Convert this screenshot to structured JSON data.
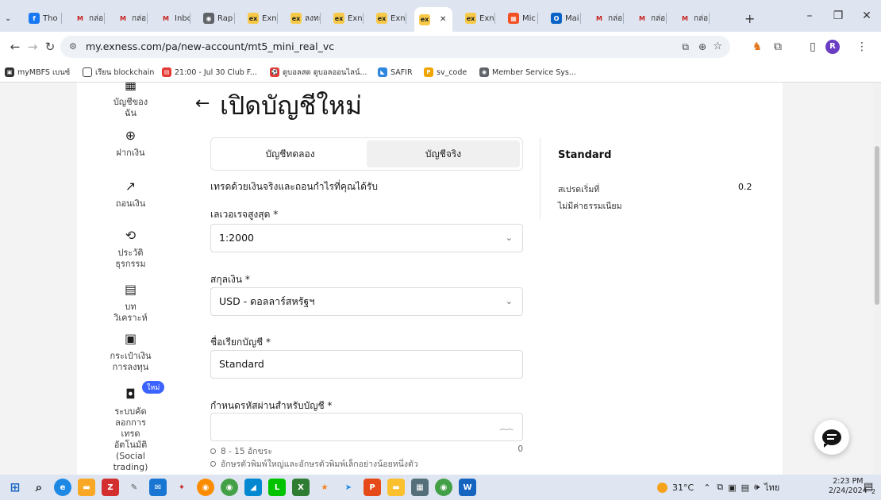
{
  "browser": {
    "tabs": [
      {
        "label": "Tho",
        "icon": "facebook-icon",
        "color": "#1877f2",
        "glyph": "f"
      },
      {
        "label": "กล่อ",
        "icon": "gmail-icon",
        "color": "#ffffff",
        "glyph": "M"
      },
      {
        "label": "กล่อ",
        "icon": "gmail-icon",
        "color": "#ffffff",
        "glyph": "M"
      },
      {
        "label": "Inbc",
        "icon": "gmail-icon",
        "color": "#ffffff",
        "glyph": "M"
      },
      {
        "label": "Rap",
        "icon": "globe-icon",
        "color": "#5f6368",
        "glyph": "◉"
      },
      {
        "label": "Exne",
        "icon": "exness-icon",
        "color": "#f7c948",
        "glyph": "ex"
      },
      {
        "label": "ลงทะ",
        "icon": "exness-icon",
        "color": "#f7c948",
        "glyph": "ex"
      },
      {
        "label": "Exne",
        "icon": "exness-icon",
        "color": "#f7c948",
        "glyph": "ex"
      },
      {
        "label": "Exne",
        "icon": "exness-icon",
        "color": "#f7c948",
        "glyph": "ex"
      },
      {
        "label": "",
        "icon": "exness-icon",
        "color": "#f7c948",
        "glyph": "ex",
        "active": true
      },
      {
        "label": "Exne",
        "icon": "exness-icon",
        "color": "#f7c948",
        "glyph": "ex"
      },
      {
        "label": "Mic",
        "icon": "microsoft-icon",
        "color": "#f25022",
        "glyph": "▦"
      },
      {
        "label": "Mai",
        "icon": "outlook-icon",
        "color": "#0a64c8",
        "glyph": "O"
      },
      {
        "label": "กล่อ",
        "icon": "gmail-icon",
        "color": "#ffffff",
        "glyph": "M"
      },
      {
        "label": "กล่อ",
        "icon": "gmail-icon",
        "color": "#ffffff",
        "glyph": "M"
      },
      {
        "label": "กล่อ",
        "icon": "gmail-icon",
        "color": "#ffffff",
        "glyph": "M"
      }
    ],
    "url": "my.exness.com/pa/new-account/mt5_mini_real_vc",
    "profile_initial": "R",
    "bookmarks": [
      {
        "label": "myMBFS เบนซ์",
        "icon": "mbfs-icon",
        "color": "#333333",
        "glyph": "▣"
      },
      {
        "label": "เรียน blockchain",
        "icon": "folder-icon",
        "color": "#ffffff",
        "glyph": "▭"
      },
      {
        "label": "21:00 - Jul 30 Club F...",
        "icon": "calendar-icon",
        "color": "#e53935",
        "glyph": "▤"
      },
      {
        "label": "ดูบอลสด ดูบอลออนไลน์...",
        "icon": "football-icon",
        "color": "#e53935",
        "glyph": "⚽"
      },
      {
        "label": "SAFIR",
        "icon": "safir-icon",
        "color": "#2e86de",
        "glyph": "◣"
      },
      {
        "label": "sv_code",
        "icon": "pma-icon",
        "color": "#f0a500",
        "glyph": "P"
      },
      {
        "label": "Member Service Sys...",
        "icon": "globe-icon",
        "color": "#5f6368",
        "glyph": "◉"
      }
    ]
  },
  "sidebar": {
    "items": [
      {
        "label": "บัญชีของฉัน",
        "icon": "accounts-icon",
        "glyph": "▦"
      },
      {
        "label": "ฝากเงิน",
        "icon": "deposit-icon",
        "glyph": "⊕"
      },
      {
        "label": "ถอนเงิน",
        "icon": "withdraw-icon",
        "glyph": "↗"
      },
      {
        "label": "ประวัติธุรกรรม",
        "icon": "history-icon",
        "glyph": "⟲"
      },
      {
        "label": "บทวิเคราะห์",
        "icon": "analytics-icon",
        "glyph": "▤"
      },
      {
        "label": "กระเป๋าเงินการลงทุน",
        "icon": "wallet-icon",
        "glyph": "▣"
      },
      {
        "label": "ระบบคัดลอกการเทรดอัตโนมัติ (Social trading)",
        "icon": "social-trading-icon",
        "glyph": "◘",
        "badge": "ใหม่"
      }
    ]
  },
  "main": {
    "back_glyph": "←",
    "title": "เปิดบัญชีใหม่",
    "tabs": [
      {
        "label": "บัญชีทดลอง",
        "active": false
      },
      {
        "label": "บัญชีจริง",
        "active": true
      }
    ],
    "description": "เทรดด้วยเงินจริงและถอนกำไรที่คุณได้รับ",
    "leverage_label": "เลเวอเรจสูงสุด *",
    "leverage_value": "1:2000",
    "currency_label": "สกุลเงิน *",
    "currency_value": "USD - ดอลลาร์สหรัฐฯ",
    "nickname_label": "ชื่อเรียกบัญชี *",
    "nickname_value": "Standard",
    "password_label": "กำหนดรหัสผ่านสำหรับบัญชี *",
    "password_value": "",
    "password_hints": [
      {
        "text": "8 - 15 อักขระ",
        "count": "0"
      },
      {
        "text": "อักษรตัวพิมพ์ใหญ่และอักษรตัวพิมพ์เล็กอย่างน้อยหนึ่งตัว"
      }
    ]
  },
  "summary": {
    "title": "Standard",
    "spread_label": "สเปรดเริ่มที่",
    "spread_value": "0.2",
    "commission_label": "ไม่มีค่าธรรมเนียม"
  },
  "taskbar": {
    "weather": "31°C",
    "lang": "ไทย",
    "time": "2:23 PM",
    "date": "2/24/2024",
    "notif_count": "2"
  }
}
